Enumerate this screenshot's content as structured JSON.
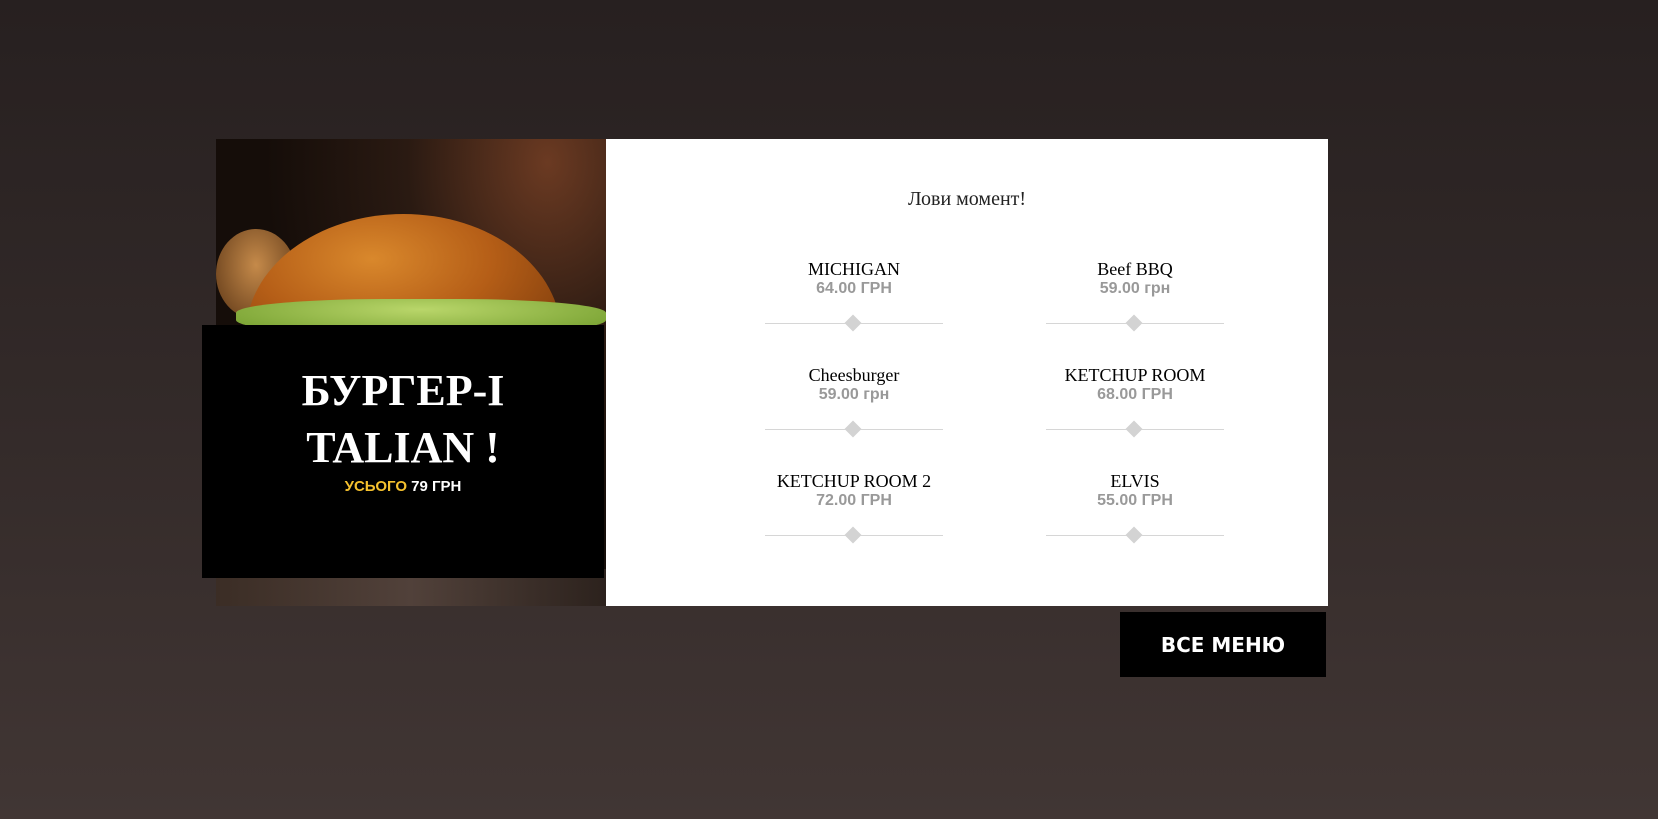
{
  "promo": {
    "title": "БУРГЕР-ITALIAN !",
    "total_label": "УСЬОГО",
    "total_value": "79 ГРН"
  },
  "menu": {
    "slogan": "Лови момент!",
    "items": [
      {
        "name": "MICHIGAN",
        "price": "64.00 ГРН"
      },
      {
        "name": "Beef BBQ",
        "price": "59.00 грн"
      },
      {
        "name": "Cheesburger",
        "price": "59.00 грн"
      },
      {
        "name": "KETCHUP ROOM",
        "price": "68.00 ГРН"
      },
      {
        "name": "KETCHUP ROOM 2",
        "price": "72.00 ГРН"
      },
      {
        "name": "ELVIS",
        "price": "55.00 ГРН"
      }
    ]
  },
  "all_menu_button": "ВСЕ МЕНЮ",
  "colors": {
    "accent": "#f5c12e",
    "price": "#999999",
    "button": "#000000"
  }
}
